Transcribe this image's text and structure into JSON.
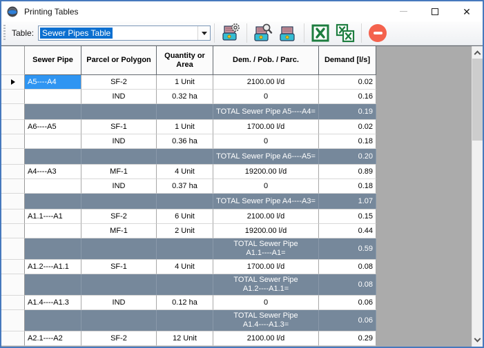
{
  "window": {
    "title": "Printing Tables"
  },
  "toolbar": {
    "table_label": "Table:",
    "combo_value": "Sewer Pipes Table",
    "buttons": [
      "print-setup",
      "print-preview",
      "print",
      "export-excel",
      "export-excel-all",
      "close-tables"
    ]
  },
  "grid": {
    "headers": [
      "Sewer Pipe",
      "Parcel or Polygon",
      "Quantity or Area",
      "Dem. / Pob. / Parc.",
      "Demand [l/s]"
    ],
    "rows": [
      {
        "type": "data",
        "pipe": "A5----A4",
        "parcel": "SF-2",
        "qty": "1 Unit",
        "dem": "2100.00 l/d",
        "demand": "0.02",
        "selected": true,
        "marker": true
      },
      {
        "type": "data",
        "pipe": "",
        "parcel": "IND",
        "qty": "0.32 ha",
        "dem": "0",
        "demand": "0.16"
      },
      {
        "type": "total",
        "label_lines": [
          "TOTAL Sewer Pipe A5----A4="
        ],
        "demand": "0.19"
      },
      {
        "type": "data",
        "pipe": "A6----A5",
        "parcel": "SF-1",
        "qty": "1 Unit",
        "dem": "1700.00 l/d",
        "demand": "0.02"
      },
      {
        "type": "data",
        "pipe": "",
        "parcel": "IND",
        "qty": "0.36 ha",
        "dem": "0",
        "demand": "0.18"
      },
      {
        "type": "total",
        "label_lines": [
          "TOTAL Sewer Pipe A6----A5="
        ],
        "demand": "0.20"
      },
      {
        "type": "data",
        "pipe": "A4----A3",
        "parcel": "MF-1",
        "qty": "4 Unit",
        "dem": "19200.00 l/d",
        "demand": "0.89"
      },
      {
        "type": "data",
        "pipe": "",
        "parcel": "IND",
        "qty": "0.37 ha",
        "dem": "0",
        "demand": "0.18"
      },
      {
        "type": "total",
        "label_lines": [
          "TOTAL Sewer Pipe A4----A3="
        ],
        "demand": "1.07"
      },
      {
        "type": "data",
        "pipe": "A1.1----A1",
        "parcel": "SF-2",
        "qty": "6 Unit",
        "dem": "2100.00 l/d",
        "demand": "0.15"
      },
      {
        "type": "data",
        "pipe": "",
        "parcel": "MF-1",
        "qty": "2 Unit",
        "dem": "19200.00 l/d",
        "demand": "0.44"
      },
      {
        "type": "total",
        "label_lines": [
          "TOTAL Sewer Pipe",
          "A1.1----A1="
        ],
        "demand": "0.59"
      },
      {
        "type": "data",
        "pipe": "A1.2----A1.1",
        "parcel": "SF-1",
        "qty": "4 Unit",
        "dem": "1700.00 l/d",
        "demand": "0.08"
      },
      {
        "type": "total",
        "label_lines": [
          "TOTAL Sewer Pipe",
          "A1.2----A1.1="
        ],
        "demand": "0.08"
      },
      {
        "type": "data",
        "pipe": "A1.4----A1.3",
        "parcel": "IND",
        "qty": "0.12 ha",
        "dem": "0",
        "demand": "0.06"
      },
      {
        "type": "total",
        "label_lines": [
          "TOTAL Sewer Pipe",
          "A1.4----A1.3="
        ],
        "demand": "0.06"
      },
      {
        "type": "data",
        "pipe": "A2.1----A2",
        "parcel": "SF-2",
        "qty": "12 Unit",
        "dem": "2100.00 l/d",
        "demand": "0.29"
      }
    ]
  },
  "colors": {
    "window_border": "#4679bd",
    "combo_selection": "#0b6fd0",
    "cell_selection": "#2f95f2",
    "total_row": "#76889b",
    "grid_background": "#ababab",
    "excel_green": "#1d7d3f",
    "delete_red": "#f4624d"
  }
}
